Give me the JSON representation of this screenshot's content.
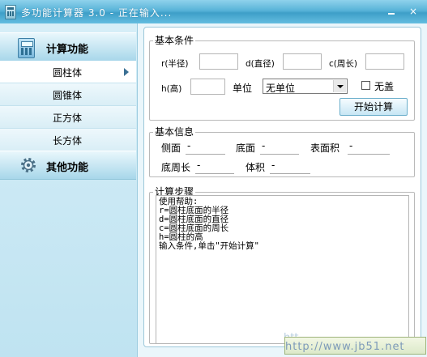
{
  "window": {
    "title": "多功能计算器 3.0 - 正在输入..."
  },
  "sidebar": {
    "sections": [
      {
        "label": "计算功能",
        "icon": "calculator-icon"
      },
      {
        "label": "其他功能",
        "icon": "gear-icon"
      }
    ],
    "items": [
      {
        "label": "圆柱体",
        "active": true
      },
      {
        "label": "圆锥体"
      },
      {
        "label": "正方体"
      },
      {
        "label": "长方体"
      }
    ]
  },
  "basic_conditions": {
    "legend": "基本条件",
    "r_label": "r(半径)",
    "d_label": "d(直径)",
    "c_label": "c(周长)",
    "h_label": "h(高)",
    "unit_label": "单位",
    "unit_value": "无单位",
    "no_lid_label": "无盖",
    "start_button": "开始计算"
  },
  "basic_info": {
    "legend": "基本信息",
    "side_label": "侧面",
    "side_value": "-",
    "base_label": "底面",
    "base_value": "-",
    "surface_label": "表面积",
    "surface_value": "-",
    "base_perimeter_label": "底周长",
    "base_perimeter_value": "-",
    "volume_label": "体积",
    "volume_value": "-"
  },
  "steps": {
    "legend": "计算步骤",
    "lines": [
      "使用帮助:",
      "r=圆柱底面的半径",
      "d=圆柱底面的直径",
      "c=圆柱底面的周长",
      "h=圆柱的高",
      "输入条件,单击\"开始计算\""
    ]
  },
  "watermark": {
    "text": "http://www.jb51.net",
    "left_fragment": "htt"
  },
  "colors": {
    "title_bar": "#4aa8d0",
    "sidebar": "#cde9f4",
    "panel_border": "#9cc8da"
  }
}
